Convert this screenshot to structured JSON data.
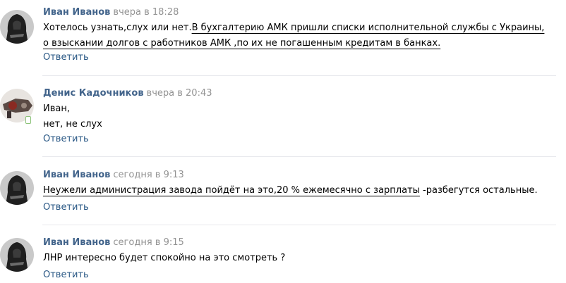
{
  "comments": [
    {
      "author": "Иван Иванов",
      "date": "вчера в 18:28",
      "text_plain": "Хотелось узнать,слух или нет.",
      "text_underlined": "В бухгалтерию АМК пришли списки исполнительной службы с Украины, о взыскании долгов с работников АМК ,по их не погашенным кредитам в банках.",
      "reply": "Ответить"
    },
    {
      "author": "Денис Кадочников",
      "date": "вчера в 20:43",
      "line1": "Иван,",
      "line2": "нет, не слух",
      "reply": "Ответить"
    },
    {
      "author": "Иван Иванов",
      "date": "сегодня в 9:13",
      "text_underlined": "Неужели администрация завода пойдёт на это,20 % ежемесячно с зарплаты",
      "text_plain": " -разбегутся остальные.",
      "reply": "Ответить"
    },
    {
      "author": "Иван Иванов",
      "date": "сегодня в 9:15",
      "text_plain": "ЛНР интересно будет спокойно на это смотреть ?",
      "reply": "Ответить"
    }
  ],
  "colors": {
    "author": "#42648b",
    "date": "#939393",
    "reply": "#2a5885",
    "divider": "#e7e8ec",
    "online": "#8ac176"
  },
  "icons": {
    "avatar_ivan": "hooded-figure-avatar",
    "avatar_denis": "mechanical-avatar",
    "online": "mobile-online-icon"
  }
}
